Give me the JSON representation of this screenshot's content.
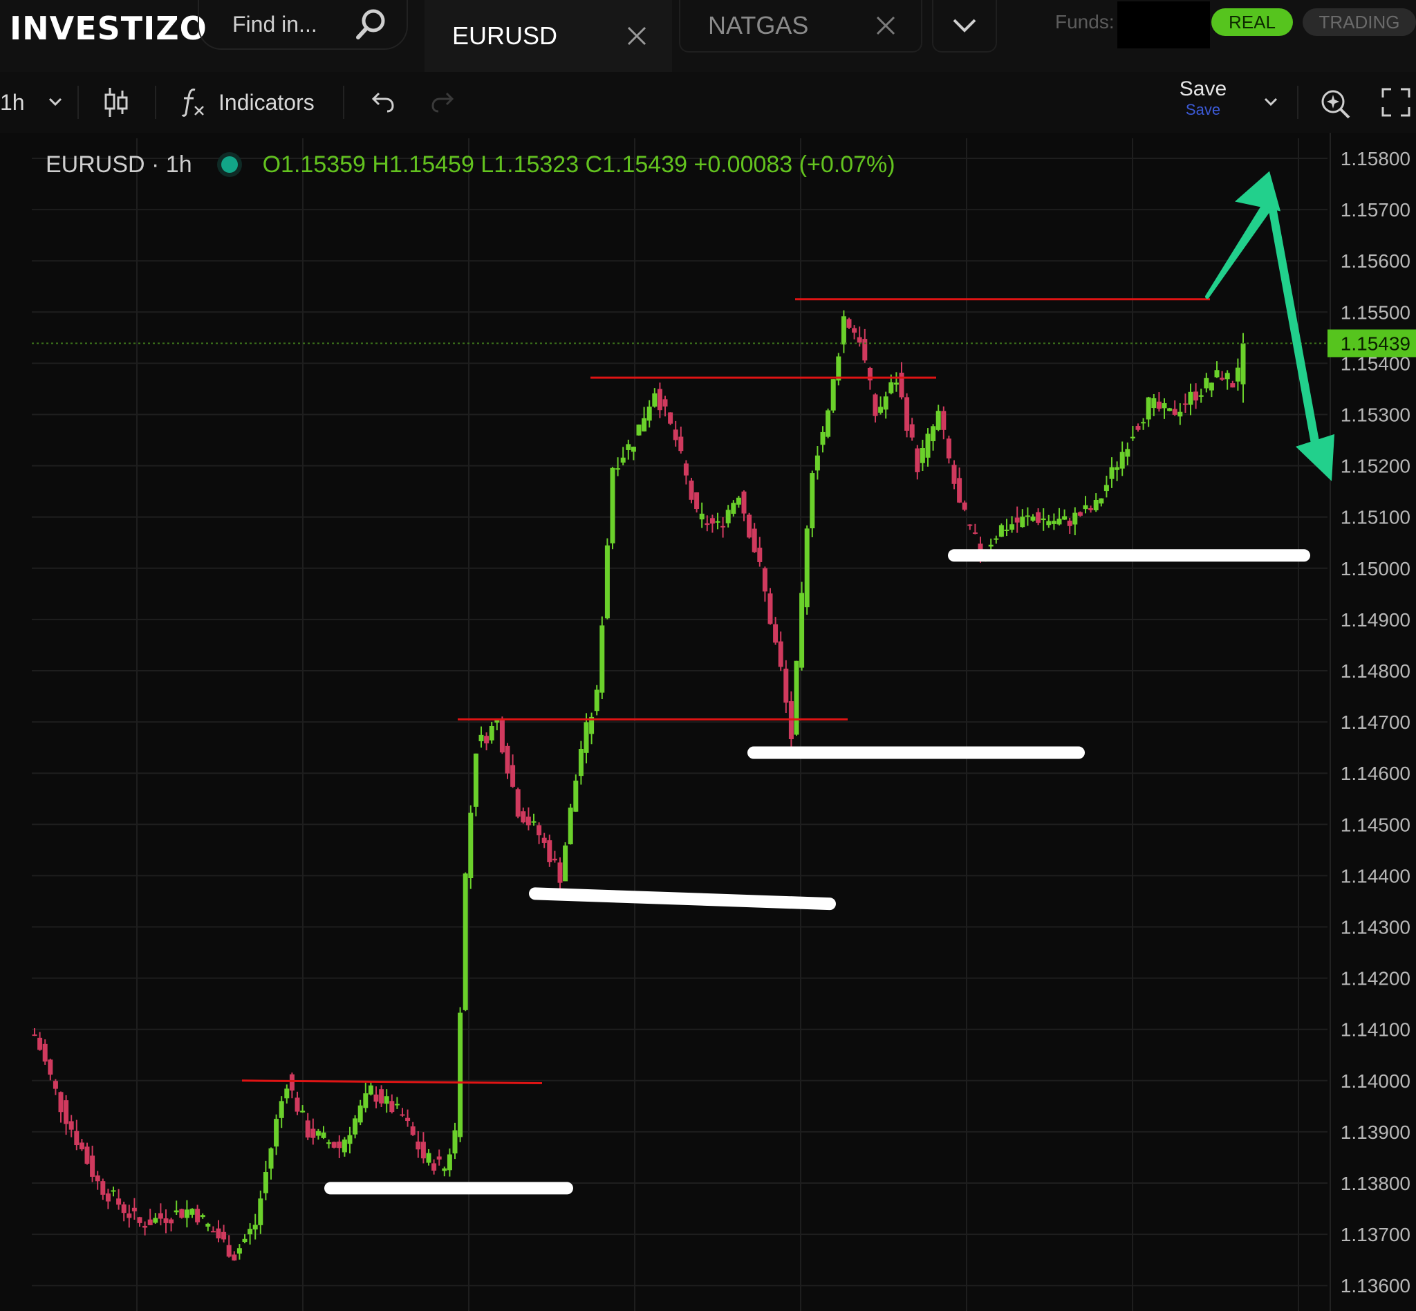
{
  "header": {
    "logo_text": "INVESTIZO",
    "search_placeholder": "Find in...",
    "tabs": [
      {
        "label": "EURUSD",
        "active": true
      },
      {
        "label": "NATGAS",
        "active": false
      }
    ],
    "funds_label": "Funds:",
    "modes": {
      "real": "REAL",
      "trading": "TRADING"
    }
  },
  "toolbar": {
    "interval": "1h",
    "indicators_label": "Indicators",
    "save_label": "Save",
    "save_sublabel": "Save"
  },
  "legend": {
    "symbol": "EURUSD · 1h",
    "ohlc": "O1.15359 H1.15459 L1.15323 C1.15439 +0.00083 (+0.07%)"
  },
  "colors": {
    "up": "#6bd12b",
    "down": "#d03a5e",
    "grid": "#1e1e1e",
    "last_price_badge": "#56c41e",
    "annotation_red": "#e01414",
    "annotation_white": "#ffffff",
    "arrow_teal": "#22d08c"
  },
  "chart_data": {
    "type": "candlestick",
    "symbol": "EURUSD",
    "interval": "1h",
    "ylim": [
      1.1358,
      1.1583
    ],
    "y_ticks": [
      "1.15800",
      "1.15700",
      "1.15600",
      "1.15500",
      "1.15400",
      "1.15300",
      "1.15200",
      "1.15100",
      "1.15000",
      "1.14900",
      "1.14800",
      "1.14700",
      "1.14600",
      "1.14500",
      "1.14400",
      "1.14300",
      "1.14200",
      "1.14100",
      "1.14000",
      "1.13900",
      "1.13800",
      "1.13700",
      "1.13600"
    ],
    "last_price": "1.15439",
    "grid": true,
    "anchors": [
      {
        "i": 0,
        "p": 1.1409
      },
      {
        "i": 5,
        "p": 1.1395
      },
      {
        "i": 12,
        "p": 1.138
      },
      {
        "i": 20,
        "p": 1.1372
      },
      {
        "i": 30,
        "p": 1.1375
      },
      {
        "i": 38,
        "p": 1.1366
      },
      {
        "i": 42,
        "p": 1.1372
      },
      {
        "i": 46,
        "p": 1.1392
      },
      {
        "i": 48,
        "p": 1.14
      },
      {
        "i": 52,
        "p": 1.139
      },
      {
        "i": 58,
        "p": 1.1387
      },
      {
        "i": 64,
        "p": 1.1398
      },
      {
        "i": 70,
        "p": 1.1393
      },
      {
        "i": 74,
        "p": 1.1385
      },
      {
        "i": 78,
        "p": 1.1383
      },
      {
        "i": 80,
        "p": 1.139
      },
      {
        "i": 82,
        "p": 1.144
      },
      {
        "i": 84,
        "p": 1.1465
      },
      {
        "i": 88,
        "p": 1.147
      },
      {
        "i": 92,
        "p": 1.1453
      },
      {
        "i": 96,
        "p": 1.1448
      },
      {
        "i": 100,
        "p": 1.144
      },
      {
        "i": 104,
        "p": 1.1465
      },
      {
        "i": 107,
        "p": 1.1475
      },
      {
        "i": 110,
        "p": 1.152
      },
      {
        "i": 114,
        "p": 1.1525
      },
      {
        "i": 118,
        "p": 1.1535
      },
      {
        "i": 122,
        "p": 1.1525
      },
      {
        "i": 126,
        "p": 1.151
      },
      {
        "i": 130,
        "p": 1.1508
      },
      {
        "i": 134,
        "p": 1.1515
      },
      {
        "i": 138,
        "p": 1.15
      },
      {
        "i": 142,
        "p": 1.148
      },
      {
        "i": 144,
        "p": 1.1467
      },
      {
        "i": 148,
        "p": 1.152
      },
      {
        "i": 151,
        "p": 1.153
      },
      {
        "i": 154,
        "p": 1.1549
      },
      {
        "i": 157,
        "p": 1.1545
      },
      {
        "i": 160,
        "p": 1.153
      },
      {
        "i": 164,
        "p": 1.1537
      },
      {
        "i": 168,
        "p": 1.152
      },
      {
        "i": 172,
        "p": 1.153
      },
      {
        "i": 176,
        "p": 1.1512
      },
      {
        "i": 180,
        "p": 1.1503
      },
      {
        "i": 184,
        "p": 1.1508
      },
      {
        "i": 190,
        "p": 1.151
      },
      {
        "i": 196,
        "p": 1.1509
      },
      {
        "i": 202,
        "p": 1.1512
      },
      {
        "i": 208,
        "p": 1.1525
      },
      {
        "i": 212,
        "p": 1.1532
      },
      {
        "i": 216,
        "p": 1.153
      },
      {
        "i": 222,
        "p": 1.1535
      },
      {
        "i": 226,
        "p": 1.1538
      },
      {
        "i": 228,
        "p": 1.1536
      },
      {
        "i": 230,
        "p": 1.15439
      }
    ],
    "annotations": {
      "red_lines": [
        {
          "p1": 1.14,
          "p2": 1.13995
        },
        {
          "p1": 1.14705,
          "p2": 1.14705
        },
        {
          "p1": 1.15372,
          "p2": 1.15372
        },
        {
          "p1": 1.15525,
          "p2": 1.15525
        }
      ],
      "white_lines": [
        {
          "p1": 1.1379,
          "p2": 1.1379
        },
        {
          "p1": 1.14365,
          "p2": 1.14345
        },
        {
          "p1": 1.1464,
          "p2": 1.1464
        },
        {
          "p1": 1.15025,
          "p2": 1.15025
        }
      ],
      "arrow_peak": 1.15775,
      "arrow_end": 1.1517
    }
  }
}
